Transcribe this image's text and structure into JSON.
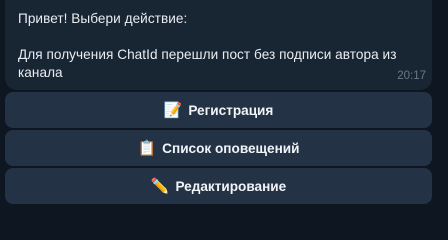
{
  "message": {
    "line1": "Привет! Выбери действие:",
    "line2": "Для получения ChatId перешли пост без подписи автора из",
    "line3": "канала",
    "time": "20:17"
  },
  "keyboard": {
    "buttons": [
      {
        "emoji": "📝",
        "label": "Регистрация"
      },
      {
        "emoji": "📋",
        "label": "Список оповещений"
      },
      {
        "emoji": "✏️",
        "label": "Редактирование"
      }
    ]
  }
}
